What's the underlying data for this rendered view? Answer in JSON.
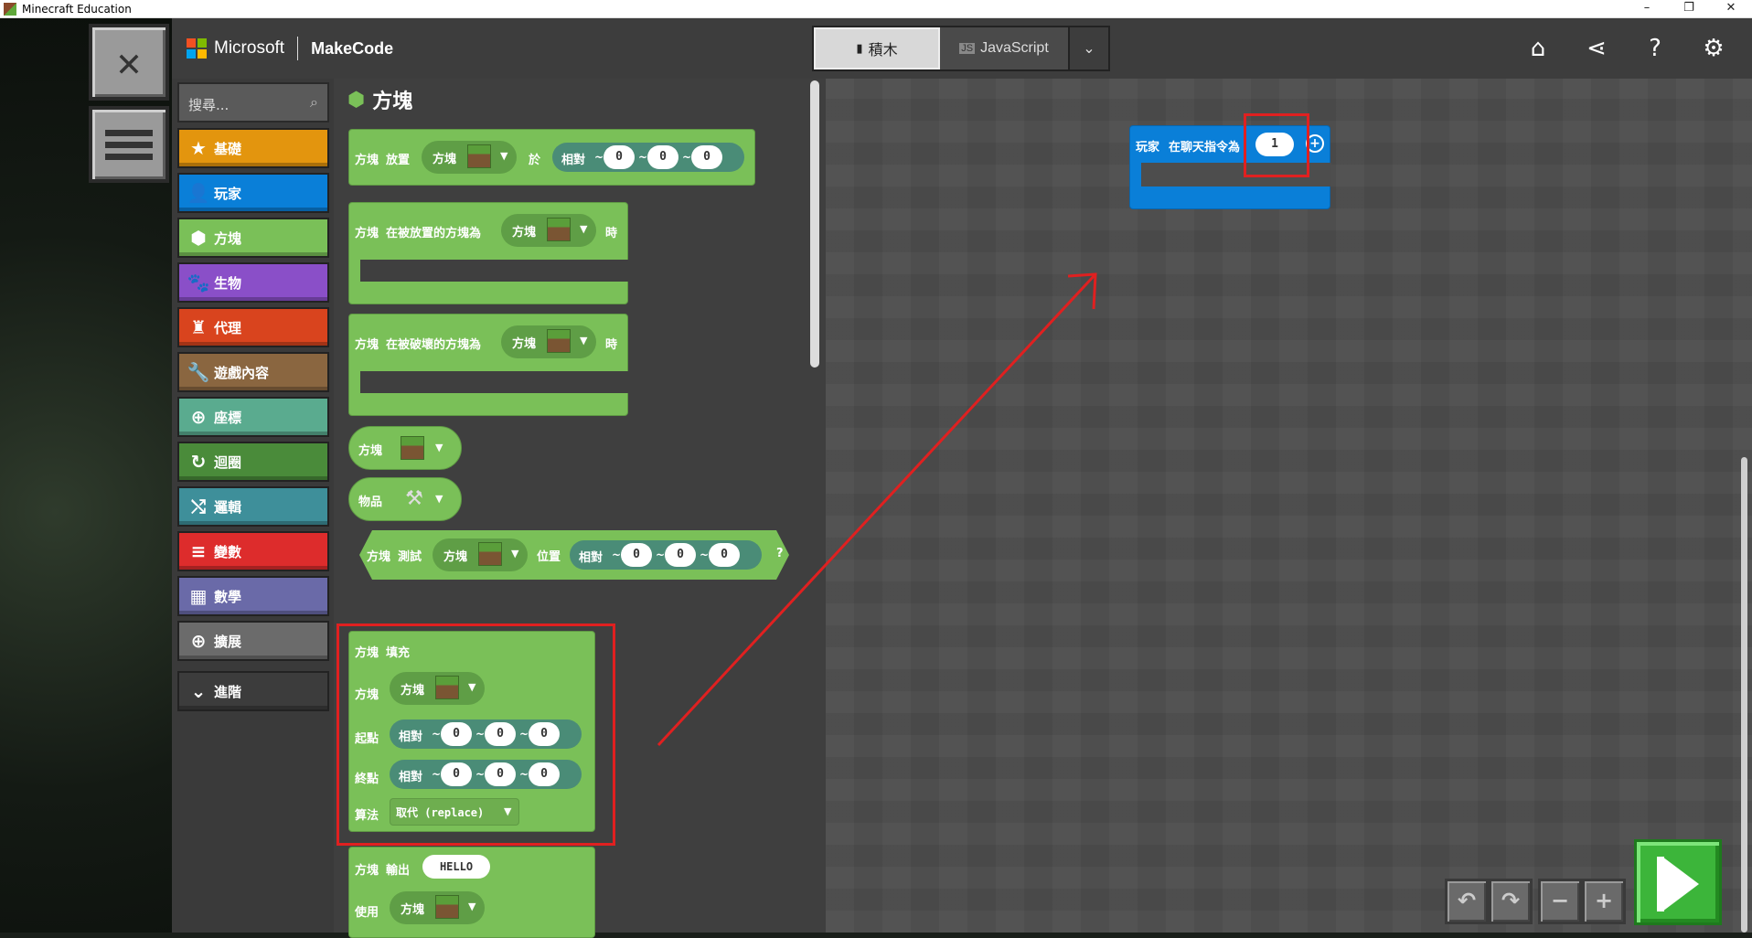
{
  "window": {
    "title": "Minecraft Education",
    "controls": [
      "–",
      "❐",
      "✕"
    ]
  },
  "left_buttons": {
    "close_glyph": "✕"
  },
  "header": {
    "brand": "Microsoft",
    "product": "MakeCode",
    "mode_tabs": [
      {
        "label": "積木",
        "active": true
      },
      {
        "label": "JavaScript",
        "active": false
      }
    ],
    "icons": [
      "home-icon",
      "share-icon",
      "help-icon",
      "settings-icon"
    ]
  },
  "toolbox": {
    "search_placeholder": "搜尋...",
    "categories": [
      {
        "label": "基礎",
        "color": "#e3950e"
      },
      {
        "label": "玩家",
        "color": "#0a7fd8"
      },
      {
        "label": "方塊",
        "color": "#7ac058"
      },
      {
        "label": "生物",
        "color": "#8a4fc8"
      },
      {
        "label": "代理",
        "color": "#d9441e"
      },
      {
        "label": "遊戲內容",
        "color": "#8a6640"
      },
      {
        "label": "座標",
        "color": "#5aab8f"
      },
      {
        "label": "迴圈",
        "color": "#4a8b3a"
      },
      {
        "label": "邏輯",
        "color": "#3e8f9a"
      },
      {
        "label": "變數",
        "color": "#dd2c2c"
      },
      {
        "label": "數學",
        "color": "#6a6aa8"
      },
      {
        "label": "擴展",
        "color": "#6b6b6b"
      },
      {
        "label": "進階",
        "color": "#3c3c3c"
      }
    ]
  },
  "flyout": {
    "title": "方塊",
    "block1": {
      "a": "方塊",
      "b": "放置",
      "c": "方塊",
      "d": "於",
      "e": "相對",
      "v": [
        "0",
        "0",
        "0"
      ]
    },
    "block2": {
      "a": "方塊",
      "b": "在被放置的方塊為",
      "c": "方塊",
      "d": "時"
    },
    "block3": {
      "a": "方塊",
      "b": "在被破壞的方塊為",
      "c": "方塊",
      "d": "時"
    },
    "block4": {
      "a": "方塊"
    },
    "block5": {
      "a": "物品"
    },
    "block6": {
      "a": "方塊",
      "b": "測試",
      "c": "方塊",
      "d": "位置",
      "e": "相對",
      "v": [
        "0",
        "0",
        "0"
      ],
      "q": "?"
    },
    "fill": {
      "a": "方塊",
      "b": "填充",
      "row_block": "方塊",
      "row_block_val": "方塊",
      "from": "起點",
      "to": "終點",
      "rel": "相對",
      "from_v": [
        "0",
        "0",
        "0"
      ],
      "to_v": [
        "0",
        "0",
        "0"
      ],
      "alg": "算法",
      "alg_val": "取代 (replace)"
    },
    "print": {
      "a": "方塊",
      "b": "輸出",
      "text": "HELLO",
      "use": "使用",
      "use_val": "方塊"
    }
  },
  "workspace": {
    "event_block": {
      "a": "玩家",
      "b": "在聊天指令為",
      "value": "1",
      "color": "#0a7fd8"
    }
  },
  "controls": [
    "undo-icon",
    "redo-icon",
    "zoom-out-icon",
    "zoom-in-icon"
  ]
}
